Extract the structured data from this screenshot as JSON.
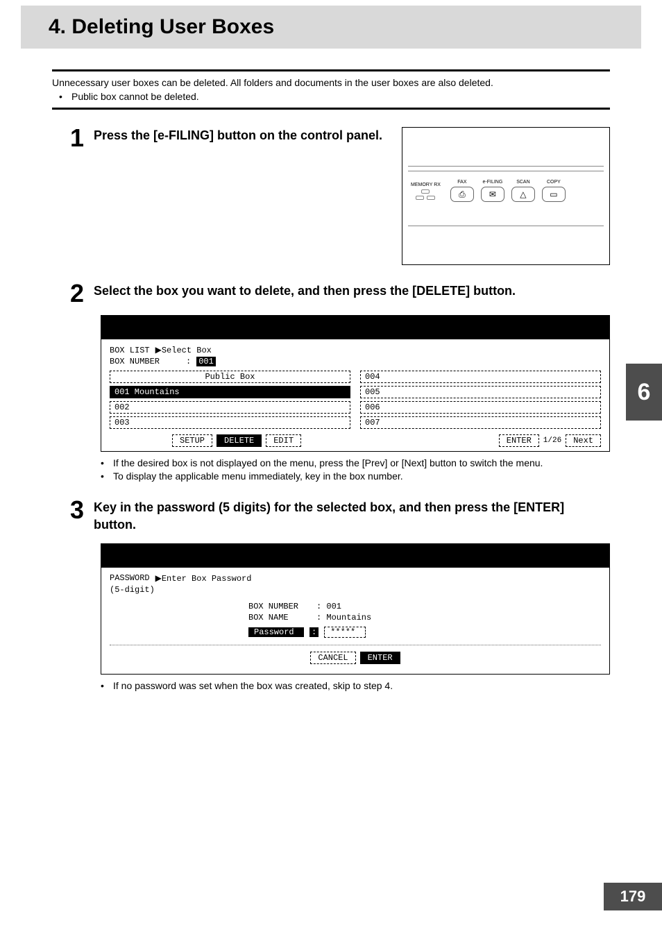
{
  "title": "4. Deleting User Boxes",
  "intro": "Unnecessary user boxes can be deleted. All folders and documents in the user boxes are also deleted.",
  "intro_bullet": "Public box cannot be deleted.",
  "steps": {
    "s1": {
      "num": "1",
      "title": "Press the [e-FILING] button on the control panel."
    },
    "s2": {
      "num": "2",
      "title": "Select the box you want to delete, and then press the [DELETE] button.",
      "notes": [
        "If the desired box is not displayed on the menu, press the [Prev] or [Next] button to switch the menu.",
        "To display the applicable menu immediately, key in the box number."
      ]
    },
    "s3": {
      "num": "3",
      "title": "Key in the password (5 digits) for the selected box, and then press the [ENTER] button.",
      "notes": [
        "If no password was set when the box was created, skip to step 4."
      ]
    }
  },
  "panel": {
    "labels": {
      "memory_rx": "MEMORY RX",
      "fax": "FAX",
      "efiling": "e-FILING",
      "scan": "SCAN",
      "copy": "COPY"
    },
    "icons": {
      "fax": "⎙",
      "efiling": "✉",
      "scan": "△",
      "copy": "▭"
    }
  },
  "lcd2": {
    "line1_a": "BOX LIST",
    "line1_b": "▶Select Box",
    "line2_a": "BOX NUMBER",
    "line2_col": ":",
    "box_number": "001",
    "left": [
      "Public Box",
      "001 Mountains",
      "002",
      "003"
    ],
    "right": [
      "004",
      "005",
      "006",
      "007"
    ],
    "btns": {
      "setup": "SETUP",
      "delete": "DELETE",
      "edit": "EDIT",
      "enter": "ENTER",
      "next": "Next"
    },
    "page": "1/26"
  },
  "lcd3": {
    "h1_a": "PASSWORD",
    "h1_b": "▶Enter Box Password",
    "h2": "(5-digit)",
    "box_number_lbl": "BOX NUMBER",
    "box_number_val": ":  001",
    "box_name_lbl": "BOX NAME",
    "box_name_val": ":  Mountains",
    "password_lbl": "Password",
    "password_colon": ":",
    "password_val": "*****",
    "cancel": "CANCEL",
    "enter": "ENTER"
  },
  "chapter_tab": "6",
  "page_number": "179"
}
